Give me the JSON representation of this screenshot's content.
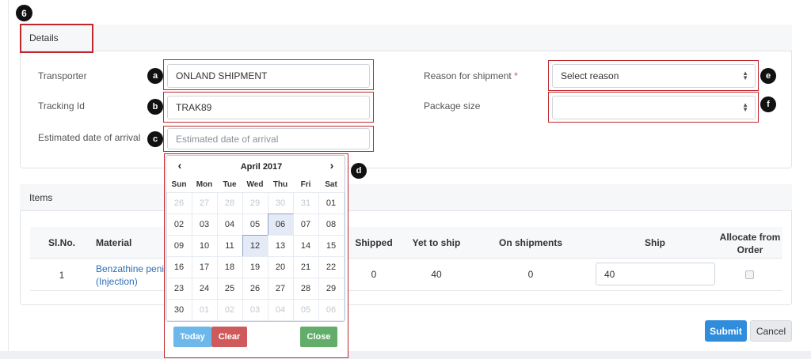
{
  "step_badge": "6",
  "details": {
    "tab_label": "Details",
    "transporter": {
      "label": "Transporter",
      "value": "ONLAND SHIPMENT",
      "callout": "a"
    },
    "tracking": {
      "label": "Tracking Id",
      "value": "TRAK89",
      "callout": "b"
    },
    "eta": {
      "label": "Estimated date of arrival",
      "placeholder": "Estimated date of arrival",
      "callout": "c"
    },
    "reason": {
      "label": "Reason for shipment",
      "required_mark": "*",
      "value": "Select reason",
      "callout": "e"
    },
    "package": {
      "label": "Package size",
      "value": "",
      "callout": "f"
    }
  },
  "calendar": {
    "callout": "d",
    "prev_icon": "‹",
    "next_icon": "›",
    "title": "April 2017",
    "weekdays": [
      "Sun",
      "Mon",
      "Tue",
      "Wed",
      "Thu",
      "Fri",
      "Sat"
    ],
    "days": [
      {
        "d": "26",
        "m": true
      },
      {
        "d": "27",
        "m": true
      },
      {
        "d": "28",
        "m": true
      },
      {
        "d": "29",
        "m": true
      },
      {
        "d": "30",
        "m": true
      },
      {
        "d": "31",
        "m": true
      },
      {
        "d": "01",
        "m": false
      },
      {
        "d": "02",
        "m": false
      },
      {
        "d": "03",
        "m": false
      },
      {
        "d": "04",
        "m": false
      },
      {
        "d": "05",
        "m": false
      },
      {
        "d": "06",
        "m": false,
        "sel": true
      },
      {
        "d": "07",
        "m": false
      },
      {
        "d": "08",
        "m": false
      },
      {
        "d": "09",
        "m": false
      },
      {
        "d": "10",
        "m": false
      },
      {
        "d": "11",
        "m": false
      },
      {
        "d": "12",
        "m": false,
        "sel": true
      },
      {
        "d": "13",
        "m": false
      },
      {
        "d": "14",
        "m": false
      },
      {
        "d": "15",
        "m": false
      },
      {
        "d": "16",
        "m": false
      },
      {
        "d": "17",
        "m": false
      },
      {
        "d": "18",
        "m": false
      },
      {
        "d": "19",
        "m": false
      },
      {
        "d": "20",
        "m": false
      },
      {
        "d": "21",
        "m": false
      },
      {
        "d": "22",
        "m": false
      },
      {
        "d": "23",
        "m": false
      },
      {
        "d": "24",
        "m": false
      },
      {
        "d": "25",
        "m": false
      },
      {
        "d": "26",
        "m": false
      },
      {
        "d": "27",
        "m": false
      },
      {
        "d": "28",
        "m": false
      },
      {
        "d": "29",
        "m": false
      },
      {
        "d": "30",
        "m": false
      },
      {
        "d": "01",
        "m": true
      },
      {
        "d": "02",
        "m": true
      },
      {
        "d": "03",
        "m": true
      },
      {
        "d": "04",
        "m": true
      },
      {
        "d": "05",
        "m": true
      },
      {
        "d": "06",
        "m": true
      }
    ],
    "today_label": "Today",
    "clear_label": "Clear",
    "close_label": "Close",
    "colors": {
      "today": "#6cb8ea",
      "clear": "#cf5a5c",
      "close": "#62ad6a"
    }
  },
  "items": {
    "title": "Items",
    "columns": [
      "Sl.No.",
      "Material",
      "Shipped",
      "Yet to ship",
      "On shipments",
      "Ship",
      "Allocate from",
      "Order"
    ],
    "row": {
      "sl": "1",
      "material_line1": "Benzathine penic",
      "material_line2": "(Injection)",
      "shipped": "0",
      "yet_to_ship": "40",
      "on_shipments": "0",
      "ship_value": "40"
    }
  },
  "actions": {
    "submit": "Submit",
    "cancel": "Cancel"
  }
}
